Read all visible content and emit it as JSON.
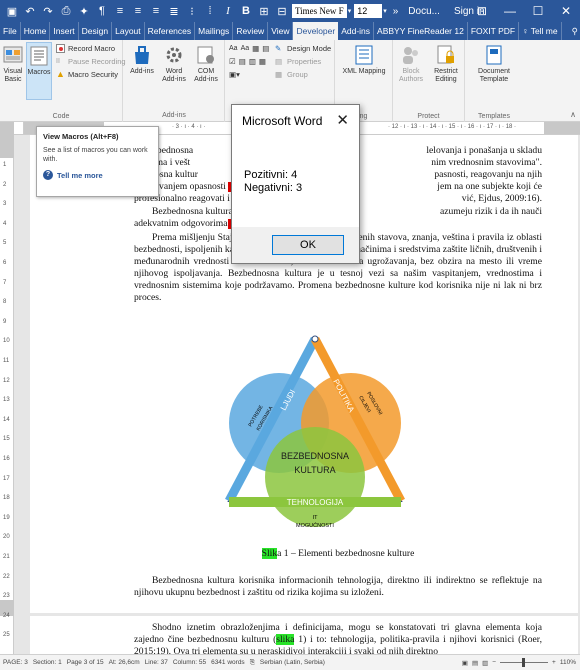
{
  "titlebar": {
    "font_name": "Times New F",
    "font_size": "12",
    "more": "»",
    "doc_title": "Docu...",
    "sign_in": "Sign in"
  },
  "tabs": [
    "File",
    "Home",
    "Insert",
    "Design",
    "Layout",
    "References",
    "Mailings",
    "Review",
    "View",
    "Developer",
    "Add-ins",
    "ABBYY FineReader 12",
    "FOXIT PDF"
  ],
  "active_tab": "Developer",
  "tell_me": "Tell me",
  "share": "Share",
  "ribbon": {
    "code": {
      "label": "Code",
      "visual_basic": "Visual Basic",
      "macros": "Macros",
      "record_macro": "Record Macro",
      "pause_recording": "Pause Recording",
      "macro_security": "Macro Security"
    },
    "addins": {
      "label": "Add-ins",
      "add_ins": "Add-ins",
      "word_addins": "Word Add-ins",
      "com_addins": "COM Add-ins"
    },
    "controls": {
      "design_mode": "Design Mode",
      "properties": "Properties",
      "group": "Group"
    },
    "mapping": {
      "xml_mapping": "XML Mapping",
      "label": "ng"
    },
    "protect": {
      "label": "Protect",
      "block_authors": "Block Authors",
      "restrict_editing": "Restrict Editing"
    },
    "templates": {
      "label": "Templates",
      "document_template": "Document Template"
    }
  },
  "ruler_top_numbers": "· 3 · ı · 4 · ı ·",
  "ruler_top_right": "· 12 · ı · 13 · ı · 14 · ı · 15 · ı · 16 · ı · 17 · ı · 18 ·",
  "ruler_left_numbers": [
    "1",
    "2",
    "3",
    "4",
    "5",
    "6",
    "7",
    "8",
    "9",
    "10",
    "11",
    "12",
    "13",
    "14",
    "15",
    "16",
    "17",
    "18",
    "19",
    "20",
    "21",
    "22",
    "23",
    "24",
    "25"
  ],
  "tooltip": {
    "title": "View Macros (Alt+F8)",
    "desc": "See a list of macros you can work with.",
    "more": "Tell me more"
  },
  "msgbox": {
    "title": "Microsoft Word",
    "line1": "Pozitivni:  4",
    "line2": "Negativni:  3",
    "ok": "OK"
  },
  "doc": {
    "p1_l1": "... bezbednosna",
    "p1_l1b": "lelovanja i ponašanja u skladu",
    "p1_l2": "...anjima i vešt",
    "p1_l2b": "nim vrednosnim stavovima\".",
    "p1_l3": "...ednosna kultur",
    "p1_l3b": "pasnosti, reagovanju na njih",
    "p1_l4": "izbegavanjem opasnosti",
    "p1_l4b": "ot",
    "p1_l4c": "jem na one subjekte koji će",
    "p1_l5": "profesionalno reagovati i sačuv",
    "p1_l5b": "vić, Ejdus, 2009:16).",
    "p2_l1": "Bezbednosna kultura treb",
    "p2_l1b": "azumeju rizik i da ih nauči",
    "p2_l2": "adekvatnim odgovorima",
    "p3": "Prema mišljenju Stajića i ... ra predstavlja skup usvojenih stavova, znanja, veština i pravila iz oblasti bezbednosti, ispoljenih kao ponašanje i proces, o potrebi, načinima i sredstvima zaštite ličnih, društvenih i međunarodnih vrednosti od svih izvora, oblika i nosilaca ugrožavanja, bez obzira na mesto ili vreme njihovog ispoljavanja. Bezbednosna kultura je u tesnoj vezi sa našim vaspitanjem, vrednostima i vrednosnim sistemima koje podržavamo. Promena bezbednosne kulture kod korisnika nije ni lak ni brz proces.",
    "caption_hl": "Slik",
    "caption": "a 1 – Elementi bezbednosne kulture",
    "p4": "Bezbednosna kultura korisnika informacionih tehnologija, direktno ili indirektno se reflektuje na njihovu ukupnu bezbednost i zaštitu od rizika kojima su izloženi.",
    "p5_a": "Shodno iznetim obrazloženjima i definicijama, mogu se konstatovati tri glavna elementa koja zajedno čine bezbednosnu kulturu (",
    "p5_hl": "slika",
    "p5_b": " 1) i to: tehnologija, politika-pravila i njihovi korisnici (Roer, 2015:19). Ova tri elementa su u neraskidivoj interakciji i svaki od njih direktno"
  },
  "diagram": {
    "ljudi": "LJUDI",
    "politika": "POLITIKA",
    "tehnologija": "TEHNOLOGIJA",
    "center1": "BEZBEDNOSNA",
    "center2": "KULTURA",
    "left1": "POTREBE",
    "left2": "KORISNIKA",
    "right1": "POSLOVNI",
    "right2": "CILJEVI",
    "bottom1": "IT",
    "bottom2": "MOGUĆNOSTI",
    "colors": {
      "blue": "#5aa8df",
      "orange": "#f39a2b",
      "green": "#8cc63e",
      "dark": "#2f4b7c"
    }
  },
  "status": {
    "page": "PAGE: 3",
    "section": "Section: 1",
    "page_of": "Page 3 of 15",
    "at": "At: 26,6cm",
    "line": "Line: 37",
    "column": "Column: 55",
    "words": "6341 words",
    "language": "Serbian (Latin, Serbia)",
    "zoom": "110%"
  }
}
